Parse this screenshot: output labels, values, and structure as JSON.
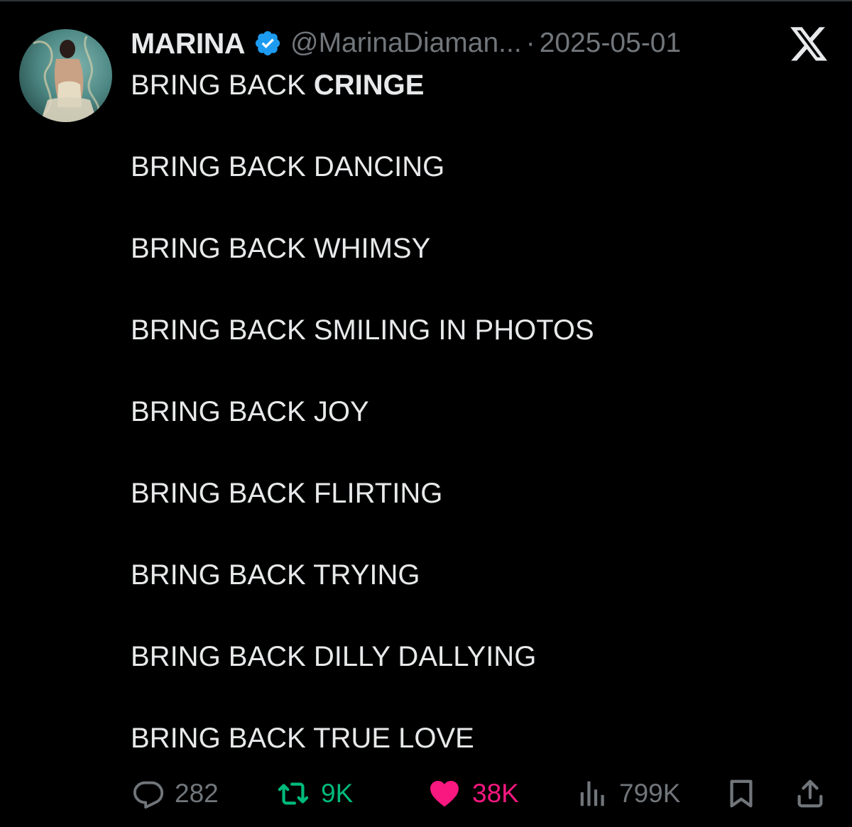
{
  "tweet": {
    "author_name": "MARINA",
    "handle": "@MarinaDiaman...",
    "separator": "·",
    "date": "2025-05-01",
    "first_line_prefix": "BRING BACK ",
    "first_line_bold": "CRINGE",
    "lines": [
      "BRING BACK DANCING",
      "BRING BACK WHIMSY",
      "BRING BACK SMILING IN PHOTOS",
      "BRING BACK JOY",
      "BRING BACK FLIRTING",
      "BRING BACK TRYING",
      "BRING BACK DILLY DALLYING",
      "BRING BACK TRUE LOVE"
    ]
  },
  "actions": {
    "replies": "282",
    "retweets": "9K",
    "likes": "38K",
    "views": "799K"
  },
  "icons": {
    "verified": "verified-badge-icon",
    "logo": "x-logo-icon",
    "reply": "reply-icon",
    "retweet": "retweet-icon",
    "like": "heart-icon",
    "views": "views-icon",
    "bookmark": "bookmark-icon",
    "share": "share-icon"
  },
  "colors": {
    "background": "#000000",
    "text": "#e7e9ea",
    "muted": "#71767b",
    "verified": "#1d9bf0",
    "retweet": "#00ba7c",
    "like": "#f91880"
  }
}
